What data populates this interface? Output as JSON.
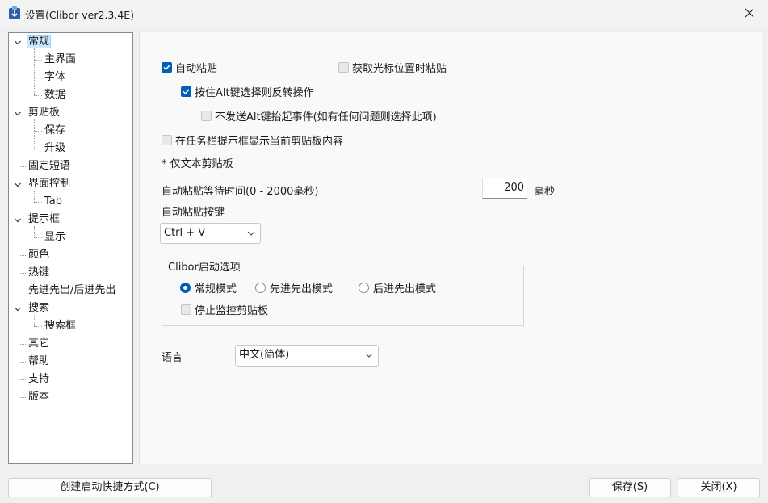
{
  "window": {
    "title": "设置(Clibor ver2.3.4E)"
  },
  "tree": {
    "items": [
      {
        "label": "常规",
        "level": 0,
        "expanded": true,
        "selected": true
      },
      {
        "label": "主界面",
        "level": 1
      },
      {
        "label": "字体",
        "level": 1
      },
      {
        "label": "数据",
        "level": 1
      },
      {
        "label": "剪贴板",
        "level": 0,
        "expanded": true
      },
      {
        "label": "保存",
        "level": 1
      },
      {
        "label": "升级",
        "level": 1
      },
      {
        "label": "固定短语",
        "level": 0
      },
      {
        "label": "界面控制",
        "level": 0,
        "expanded": true
      },
      {
        "label": "Tab",
        "level": 1
      },
      {
        "label": "提示框",
        "level": 0,
        "expanded": true
      },
      {
        "label": "显示",
        "level": 1
      },
      {
        "label": "颜色",
        "level": 0
      },
      {
        "label": "热键",
        "level": 0
      },
      {
        "label": "先进先出/后进先出",
        "level": 0
      },
      {
        "label": "搜索",
        "level": 0,
        "expanded": true
      },
      {
        "label": "搜索框",
        "level": 1
      },
      {
        "label": "其它",
        "level": 0
      },
      {
        "label": "帮助",
        "level": 0
      },
      {
        "label": "支持",
        "level": 0
      },
      {
        "label": "版本",
        "level": 0
      }
    ]
  },
  "general": {
    "auto_paste": {
      "label": "自动粘贴",
      "checked": true
    },
    "paste_at_cursor": {
      "label": "获取光标位置时粘贴",
      "checked": false
    },
    "alt_reverse": {
      "label": "按住Alt键选择则反转操作",
      "checked": true
    },
    "no_alt_up": {
      "label": "不发送Alt键抬起事件(如有任何问题则选择此项)",
      "checked": false
    },
    "taskbar_tooltip": {
      "label": "在任务栏提示框显示当前剪贴板内容",
      "checked": false
    },
    "text_only_note": "* 仅文本剪贴板",
    "wait_label": "自动粘贴等待时间(0 - 2000毫秒)",
    "wait_value": "200",
    "wait_unit": "毫秒",
    "paste_key_label": "自动粘贴按键",
    "paste_key_value": "Ctrl + V",
    "startup_group": {
      "title": "Clibor启动选项",
      "modes": [
        {
          "label": "常规模式",
          "checked": true
        },
        {
          "label": "先进先出模式",
          "checked": false
        },
        {
          "label": "后进先出模式",
          "checked": false
        }
      ],
      "stop_monitor": {
        "label": "停止监控剪贴板",
        "checked": false
      }
    },
    "language_label": "语言",
    "language_value": "中文(简体)"
  },
  "footer": {
    "create_shortcut": "创建启动快捷方式(C)",
    "save": "保存(S)",
    "close": "关闭(X)"
  },
  "colors": {
    "accent": "#005fb8",
    "selection": "#cce8ff"
  }
}
